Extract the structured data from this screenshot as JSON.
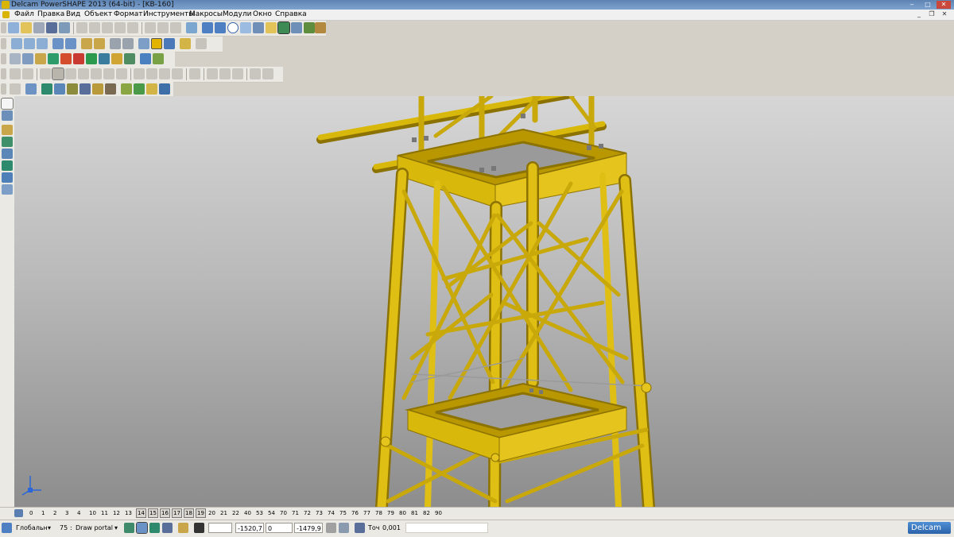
{
  "window": {
    "title": "Delcam PowerSHAPE 2013 (64-bit) - [KB-160]",
    "minimize": "‒",
    "maximize": "□",
    "close": "✕"
  },
  "menu": {
    "items": [
      "Файл",
      "Правка",
      "Вид",
      "Объект",
      "Формат",
      "Инструменты",
      "Макросы",
      "Модули",
      "Окно",
      "Справка"
    ]
  },
  "mdi_controls": {
    "minimize": "_",
    "restore": "❐",
    "close": "✕"
  },
  "levels": {
    "icon": "layers-icon",
    "items": [
      "0",
      "1",
      "2",
      "3",
      "4",
      "10",
      "11",
      "12",
      "13",
      "14",
      "15",
      "16",
      "17",
      "18",
      "19",
      "20",
      "21",
      "22",
      "40",
      "53",
      "54",
      "70",
      "71",
      "72",
      "73",
      "74",
      "75",
      "76",
      "77",
      "78",
      "79",
      "80",
      "81",
      "82",
      "90"
    ],
    "active": [
      "14",
      "15",
      "16",
      "17",
      "18",
      "19"
    ]
  },
  "status": {
    "workplane": "Глобальн",
    "level_number": "75",
    "level_name": "Draw portal",
    "coord_x": "-1520,7",
    "coord_y": "0",
    "coord_z": "-1479,9",
    "tolerance_label": "Точ",
    "tolerance_value": "0,001",
    "brand": "Delcam"
  },
  "colors": {
    "model_yellow": "#d9b80c",
    "model_shadow": "#8c7200",
    "titlebar": "#6a8fbf",
    "viewport_top": "#d6d6d6",
    "viewport_bottom": "#8d8d8d"
  }
}
